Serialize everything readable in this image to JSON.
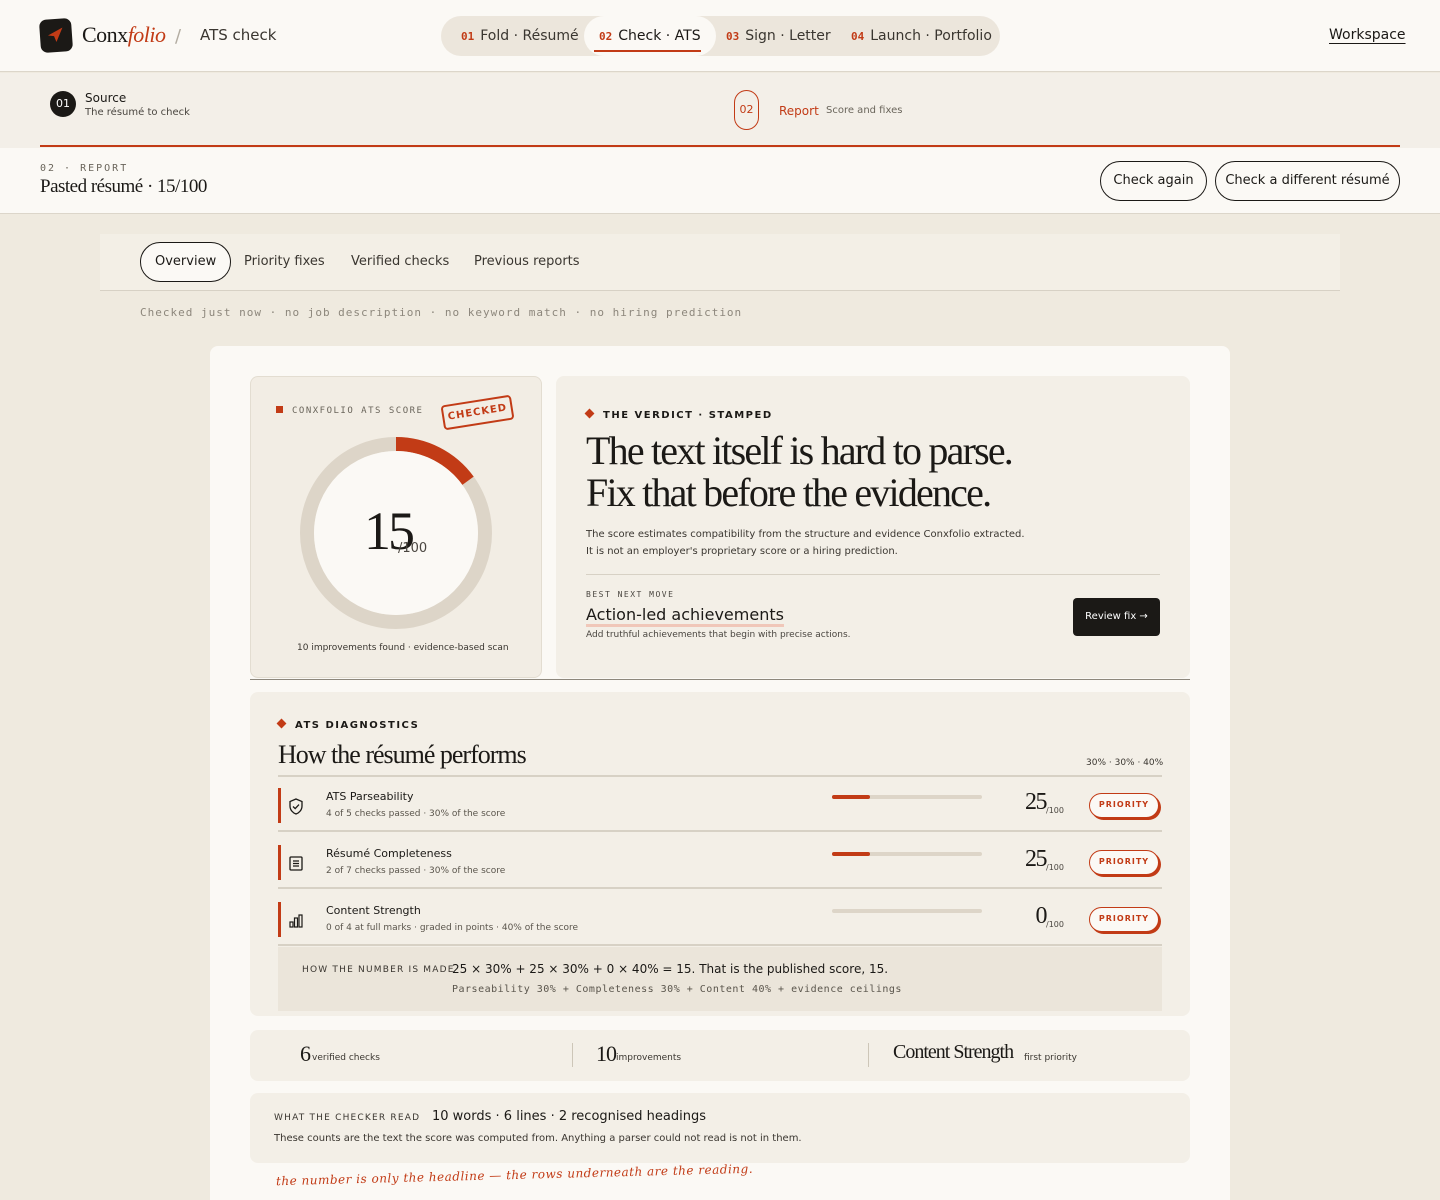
{
  "brand": {
    "name_a": "Conx",
    "name_b": "folio"
  },
  "breadcrumb": {
    "separator": "/",
    "current": "ATS check"
  },
  "nav": [
    {
      "num": "01",
      "label": "Fold · Résumé"
    },
    {
      "num": "02",
      "label": "Check · ATS"
    },
    {
      "num": "03",
      "label": "Sign · Letter"
    },
    {
      "num": "04",
      "label": "Launch · Portfolio"
    }
  ],
  "workspace_label": "Workspace",
  "steps": [
    {
      "num": "01",
      "title": "Source",
      "sub": "The résumé to check"
    },
    {
      "num": "02",
      "title": "Report",
      "sub": "Score and fixes"
    }
  ],
  "report_header": {
    "kicker": "02 · REPORT",
    "title": "Pasted résumé · 15/100",
    "check_again": "Check again",
    "check_different": "Check a different résumé"
  },
  "tabs": [
    "Overview",
    "Priority fixes",
    "Verified checks",
    "Previous reports"
  ],
  "meta_line": "Checked just now · no job description · no keyword match · no hiring prediction",
  "score": {
    "kicker": "CONXFOLIO ATS SCORE",
    "stamp": "CHECKED",
    "value": "15",
    "denominator": "/100",
    "fraction": 0.15,
    "footnote": "10 improvements found · evidence-based scan"
  },
  "verdict": {
    "kicker": "THE VERDICT · STAMPED",
    "headline_1": "The text itself is hard to parse.",
    "headline_2": "Fix that before the evidence.",
    "para_1": "The score estimates compatibility from the structure and evidence Conxfolio extracted.",
    "para_2": "It is not an employer's proprietary score or a hiring prediction.",
    "best_kicker": "BEST NEXT MOVE",
    "best_title": "Action-led achievements",
    "best_sub": "Add truthful achievements that begin with precise actions.",
    "review_label": "Review fix →"
  },
  "diagnostics": {
    "kicker": "ATS DIAGNOSTICS",
    "title": "How the résumé performs",
    "weights": "30% · 30% · 40%",
    "rows": [
      {
        "name": "ATS Parseability",
        "sub": "4 of 5 checks passed · 30% of the score",
        "value": "25",
        "den": "/100",
        "fraction": 0.25,
        "badge": "PRIORITY",
        "icon": "shield-check-icon"
      },
      {
        "name": "Résumé Completeness",
        "sub": "2 of 7 checks passed · 30% of the score",
        "value": "25",
        "den": "/100",
        "fraction": 0.25,
        "badge": "PRIORITY",
        "icon": "document-icon"
      },
      {
        "name": "Content Strength",
        "sub": "0 of 4 at full marks · graded in points · 40% of the score",
        "value": "0",
        "den": "/100",
        "fraction": 0,
        "badge": "PRIORITY",
        "icon": "bar-chart-icon"
      }
    ],
    "formula_kicker": "HOW THE NUMBER IS MADE",
    "formula_main": "25 × 30% + 25 × 30% + 0 × 40% = 15. That is the published score, 15.",
    "formula_sub": "Parseability 30% + Completeness 30% + Content 40% + evidence ceilings"
  },
  "summary": [
    {
      "num": "6",
      "label": "verified checks"
    },
    {
      "num": "10",
      "label": "improvements"
    },
    {
      "num": "Content Strength",
      "label": "first priority"
    }
  ],
  "reader": {
    "kicker": "WHAT THE CHECKER READ",
    "main": "10 words · 6 lines · 2 recognised headings",
    "sub": "These counts are the text the score was computed from. Anything a parser could not read is not in them."
  },
  "handnote": "the number is only the headline — the rows underneath are the reading.",
  "colors": {
    "accent": "#c23b16",
    "ink": "#1b1916",
    "ring_track": "#ddd5c8"
  }
}
